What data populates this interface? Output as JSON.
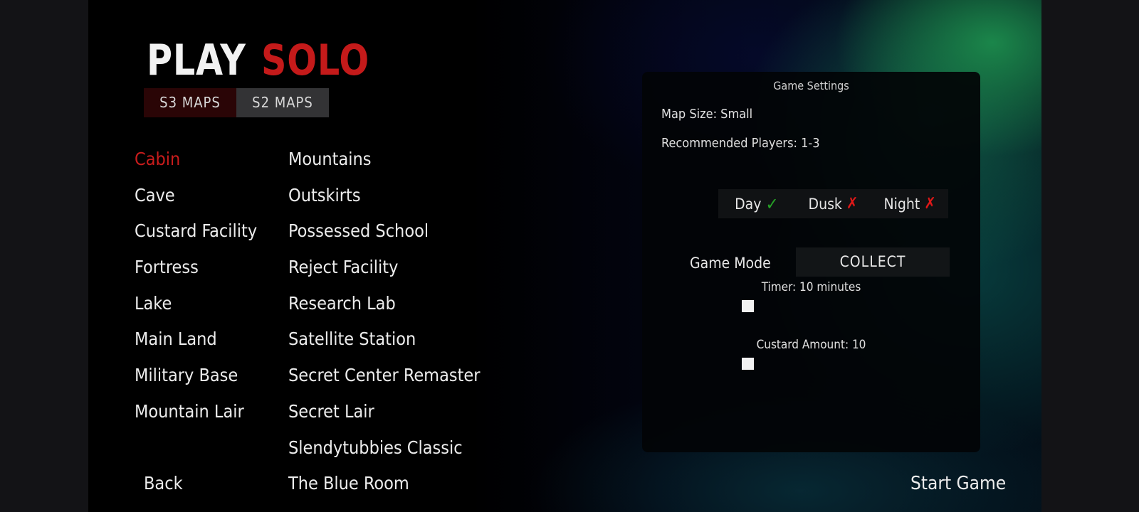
{
  "title": {
    "word1": "PLAY",
    "word2": "SOLO"
  },
  "tabs": [
    {
      "label": "S3 MAPS",
      "active": true
    },
    {
      "label": "S2 MAPS",
      "active": false
    }
  ],
  "maps": {
    "selected": "Cabin",
    "column1": [
      "Cabin",
      "Cave",
      "Custard Facility",
      "Fortress",
      "Lake",
      "Main Land",
      "Military Base",
      "Mountain Lair"
    ],
    "column2": [
      "Mountains",
      "Outskirts",
      "Possessed School",
      "Reject Facility",
      "Research Lab",
      "Satellite Station",
      "Secret Center Remaster",
      "Secret Lair",
      "Slendytubbies Classic",
      "The Blue Room"
    ]
  },
  "back_label": "Back",
  "settings": {
    "title": "Game Settings",
    "map_size": "Map Size: Small",
    "recommended_players": "Recommended Players: 1-3",
    "time_of_day": [
      {
        "label": "Day",
        "enabled": true,
        "icon": "check-icon",
        "glyph": "✓"
      },
      {
        "label": "Dusk",
        "enabled": false,
        "icon": "cross-icon",
        "glyph": "✗"
      },
      {
        "label": "Night",
        "enabled": false,
        "icon": "cross-icon",
        "glyph": "✗"
      }
    ],
    "game_mode_label": "Game Mode",
    "game_mode_value": "COLLECT",
    "timer": {
      "label": "Timer: 10 minutes",
      "value": 10,
      "fraction": 0
    },
    "custard_amount": {
      "label": "Custard Amount: 10",
      "value": 10,
      "fraction": 0
    }
  },
  "start_label": "Start Game",
  "colors": {
    "accent_red": "#c81c1c",
    "check_green": "#26a326",
    "cross_red": "#e01818",
    "active_tab_bg": "#2a0506",
    "inactive_tab_bg": "#333335"
  }
}
